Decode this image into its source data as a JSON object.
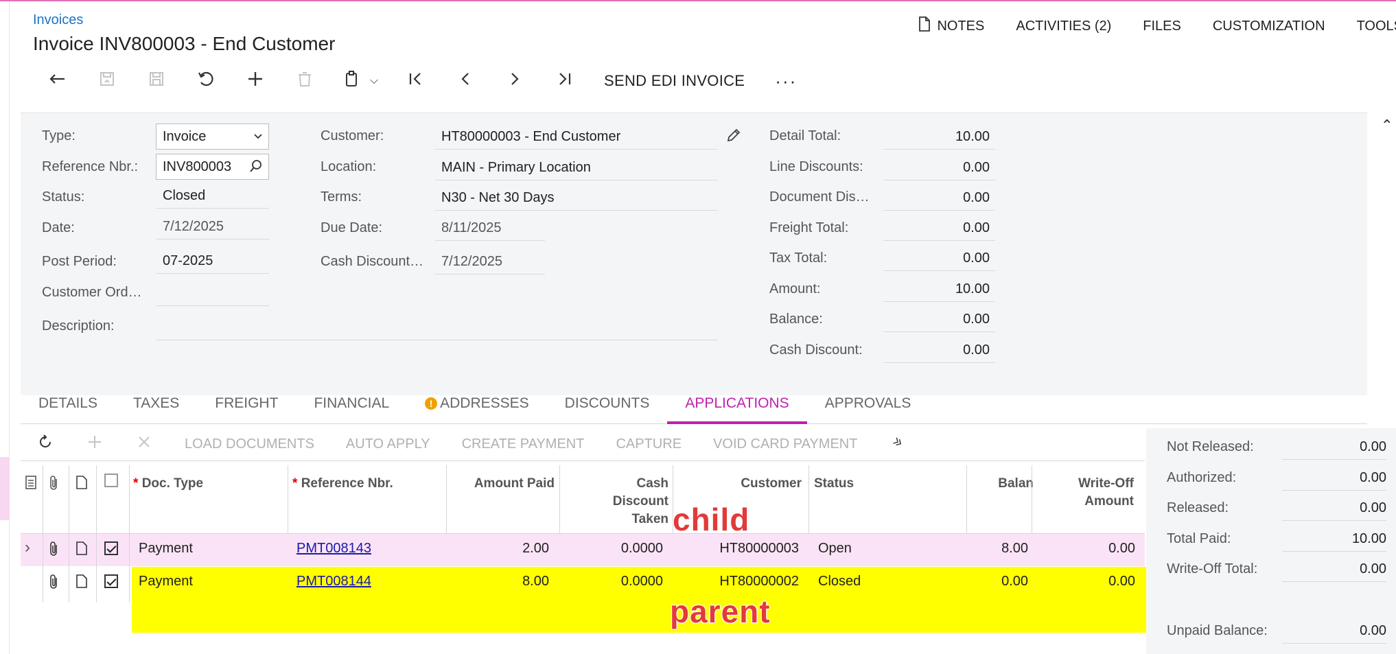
{
  "header": {
    "breadcrumb": "Invoices",
    "title": "Invoice INV800003 - End Customer",
    "nav": {
      "notes": "NOTES",
      "activities": "ACTIVITIES (2)",
      "files": "FILES",
      "customization": "CUSTOMIZATION",
      "tools": "TOOLS"
    }
  },
  "toolbar": {
    "send_edi": "SEND EDI INVOICE",
    "more": "···"
  },
  "form": {
    "type_label": "Type:",
    "type_value": "Invoice",
    "refnbr_label": "Reference Nbr.:",
    "refnbr_value": "INV800003",
    "status_label": "Status:",
    "status_value": "Closed",
    "date_label": "Date:",
    "date_value": "7/12/2025",
    "postperiod_label": "Post Period:",
    "postperiod_value": "07-2025",
    "custord_label": "Customer Ord…",
    "custord_value": "",
    "description_label": "Description:",
    "description_value": "",
    "customer_label": "Customer:",
    "customer_value": "HT80000003 - End Customer",
    "location_label": "Location:",
    "location_value": "MAIN - Primary Location",
    "terms_label": "Terms:",
    "terms_value": "N30 - Net 30 Days",
    "duedate_label": "Due Date:",
    "duedate_value": "8/11/2025",
    "cashdisc_label": "Cash Discount…",
    "cashdisc_value": "7/12/2025"
  },
  "summary": {
    "detail_total_label": "Detail Total:",
    "detail_total": "10.00",
    "line_disc_label": "Line Discounts:",
    "line_disc": "0.00",
    "doc_disc_label": "Document Dis…",
    "doc_disc": "0.00",
    "freight_label": "Freight Total:",
    "freight": "0.00",
    "tax_label": "Tax Total:",
    "tax": "0.00",
    "amount_label": "Amount:",
    "amount": "10.00",
    "balance_label": "Balance:",
    "balance": "0.00",
    "cash_disc_label": "Cash Discount:",
    "cash_disc": "0.00"
  },
  "tabs": [
    "DETAILS",
    "TAXES",
    "FREIGHT",
    "FINANCIAL",
    "ADDRESSES",
    "DISCOUNTS",
    "APPLICATIONS",
    "APPROVALS"
  ],
  "grid_toolbar": {
    "load_documents": "LOAD DOCUMENTS",
    "auto_apply": "AUTO APPLY",
    "create_payment": "CREATE PAYMENT",
    "capture": "CAPTURE",
    "void_card_payment": "VOID CARD PAYMENT"
  },
  "grid": {
    "headers": {
      "doc_type": "Doc. Type",
      "ref_nbr": "Reference Nbr.",
      "amount_paid": "Amount Paid",
      "cash_disc_1": "Cash",
      "cash_disc_2": "Discount",
      "cash_disc_3": "Taken",
      "customer": "Customer",
      "status": "Status",
      "balance": "Balan",
      "writeoff_1": "Write-Off",
      "writeoff_2": "Amount"
    },
    "rows": [
      {
        "doc_type": "Payment",
        "ref_nbr": "PMT008143",
        "amount_paid": "2.00",
        "cash_disc": "0.0000",
        "customer": "HT80000003",
        "status": "Open",
        "balance": "8.00",
        "writeoff": "0.00"
      },
      {
        "doc_type": "Payment",
        "ref_nbr": "PMT008144",
        "amount_paid": "8.00",
        "cash_disc": "0.0000",
        "customer": "HT80000002",
        "status": "Closed",
        "balance": "0.00",
        "writeoff": "0.00"
      }
    ]
  },
  "annotations": {
    "child": "child",
    "parent": "parent"
  },
  "totals": {
    "not_released_label": "Not Released:",
    "not_released": "0.00",
    "authorized_label": "Authorized:",
    "authorized": "0.00",
    "released_label": "Released:",
    "released": "0.00",
    "total_paid_label": "Total Paid:",
    "total_paid": "10.00",
    "writeoff_label": "Write-Off Total:",
    "writeoff": "0.00",
    "unpaid_label": "Unpaid Balance:",
    "unpaid": "0.00"
  },
  "colors": {
    "accent": "#c01fb0",
    "link": "#1a73c8",
    "highlight_yellow": "#ffff00",
    "highlight_pink": "#fbe3f7"
  }
}
